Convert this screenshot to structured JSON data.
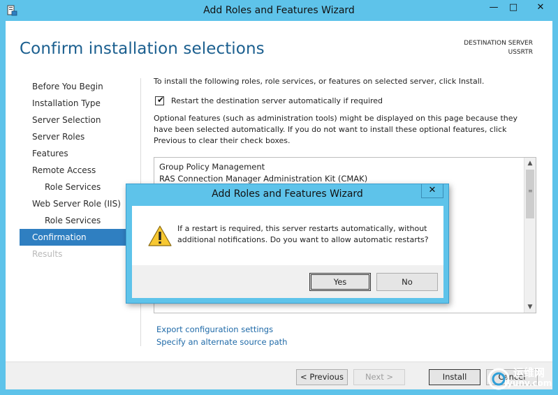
{
  "window": {
    "title": "Add Roles and Features Wizard",
    "controls": {
      "minimize": "—",
      "maximize": "□",
      "close": "✕"
    }
  },
  "header": {
    "title": "Confirm installation selections",
    "destination_label": "DESTINATION SERVER",
    "destination_server": "USSRTR"
  },
  "nav": {
    "items": [
      {
        "label": "Before You Begin",
        "state": "normal"
      },
      {
        "label": "Installation Type",
        "state": "normal"
      },
      {
        "label": "Server Selection",
        "state": "normal"
      },
      {
        "label": "Server Roles",
        "state": "normal"
      },
      {
        "label": "Features",
        "state": "normal"
      },
      {
        "label": "Remote Access",
        "state": "normal"
      },
      {
        "label": "Role Services",
        "state": "sub"
      },
      {
        "label": "Web Server Role (IIS)",
        "state": "normal"
      },
      {
        "label": "Role Services",
        "state": "sub"
      },
      {
        "label": "Confirmation",
        "state": "active"
      },
      {
        "label": "Results",
        "state": "disabled"
      }
    ]
  },
  "content": {
    "intro": "To install the following roles, role services, or features on selected server, click Install.",
    "restart_checkbox": {
      "label": "Restart the destination server automatically if required",
      "checked": true
    },
    "optional_text": "Optional features (such as administration tools) might be displayed on this page because they have been selected automatically. If you do not want to install these optional features, click Previous to clear their check boxes.",
    "list_items": [
      "Group Policy Management",
      "RAS Connection Manager Administration Kit (CMAK)"
    ],
    "links": {
      "export": "Export configuration settings",
      "alternate_source": "Specify an alternate source path"
    }
  },
  "footer": {
    "previous": "< Previous",
    "next": "Next >",
    "install": "Install",
    "cancel": "Cancel"
  },
  "dialog": {
    "title": "Add Roles and Features Wizard",
    "close": "✕",
    "message": "If a restart is required, this server restarts automatically, without additional notifications. Do you want to allow automatic restarts?",
    "yes": "Yes",
    "no": "No"
  },
  "watermark": {
    "text": "运维网",
    "url_text": "iyunv.com"
  },
  "colors": {
    "chrome": "#5ec3ea",
    "accent": "#2f7fc1",
    "title_blue": "#1b5f8f",
    "link": "#1f6aa8"
  }
}
